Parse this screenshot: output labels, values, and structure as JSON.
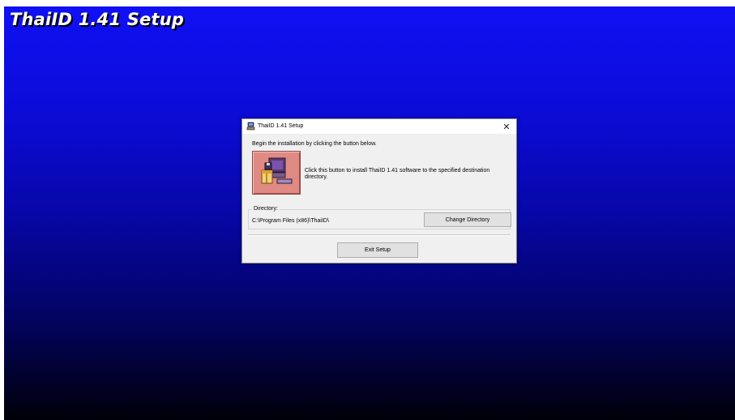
{
  "banner": {
    "title": "ThaiID 1.41 Setup"
  },
  "dialog": {
    "title": "ThaiID 1.41 Setup",
    "close_glyph": "✕",
    "instruction": "Begin the installation by clicking the button below.",
    "install_description": "Click this button to install ThaiID 1.41 software to the specified destination directory.",
    "directory": {
      "legend": "Directory:",
      "path": "C:\\Program Files (x86)\\ThaiID\\",
      "change_button_label": "Change Directory"
    },
    "exit_button_label": "Exit Setup"
  },
  "colors": {
    "background_top": "#1010f4",
    "background_bottom": "#000008",
    "install_button": "#e08a84"
  },
  "icons": {
    "app": "setup-computer-icon",
    "install": "install-computer-icon",
    "close": "close-icon"
  }
}
